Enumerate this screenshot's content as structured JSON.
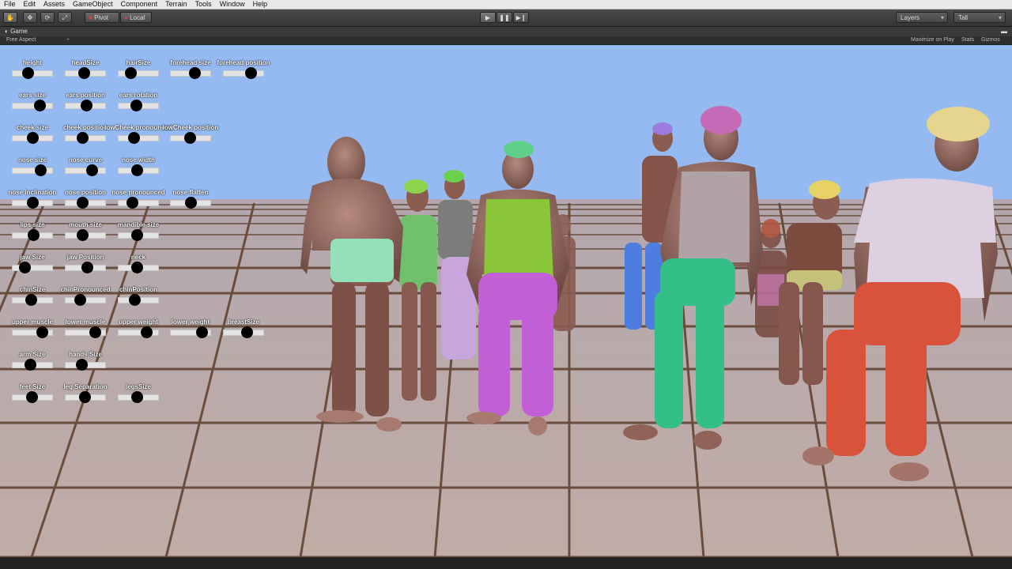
{
  "menu": [
    "File",
    "Edit",
    "Assets",
    "GameObject",
    "Component",
    "Terrain",
    "Tools",
    "Window",
    "Help"
  ],
  "toolbar": {
    "pivot": "Pivot",
    "local": "Local",
    "layers": "Layers",
    "layout": "Tall"
  },
  "tab": {
    "title": "Game"
  },
  "gamebar": {
    "aspect": "Free Aspect",
    "maximize": "Maximize on Play",
    "stats": "Stats",
    "gizmos": "Gizmos"
  },
  "sliders": [
    {
      "label": "height",
      "value": 0.35
    },
    {
      "label": "headSize",
      "value": 0.45
    },
    {
      "label": "hairSize",
      "value": 0.25
    },
    {
      "label": "forehead size",
      "value": 0.65
    },
    {
      "label": "forehead position",
      "value": 0.75
    },
    {
      "label": "ears size",
      "value": 0.75
    },
    {
      "label": "ears position",
      "value": 0.55
    },
    {
      "label": "ears rotation",
      "value": 0.42
    },
    {
      "label": "cheek size",
      "value": 0.5
    },
    {
      "label": "cheek position",
      "value": 0.4
    },
    {
      "label": "lowCheek pronounced",
      "value": 0.35
    },
    {
      "label": "lowCheek position",
      "value": 0.48
    },
    {
      "label": "nose size",
      "value": 0.78
    },
    {
      "label": "nose curve",
      "value": 0.72
    },
    {
      "label": "nose width",
      "value": 0.45
    },
    {
      "label": "nose inclination",
      "value": 0.5
    },
    {
      "label": "nose position",
      "value": 0.4
    },
    {
      "label": "nose pronounced",
      "value": 0.3
    },
    {
      "label": "nose flatten",
      "value": 0.52
    },
    {
      "label": "lips size",
      "value": 0.55
    },
    {
      "label": "mouth size",
      "value": 0.4
    },
    {
      "label": "mandible size",
      "value": 0.45
    },
    {
      "label": "jaw Size",
      "value": 0.25
    },
    {
      "label": "jaw Position",
      "value": 0.58
    },
    {
      "label": "neck",
      "value": 0.45
    },
    {
      "label": "chinSize",
      "value": 0.45
    },
    {
      "label": "chinPronounced",
      "value": 0.32
    },
    {
      "label": "chinPosition",
      "value": 0.38
    },
    {
      "label": "upper muscle",
      "value": 0.85
    },
    {
      "label": "lower muscle",
      "value": 0.85
    },
    {
      "label": "upper weight",
      "value": 0.78
    },
    {
      "label": "lower weight",
      "value": 0.88
    },
    {
      "label": "breastSize",
      "value": 0.62
    },
    {
      "label": "arm Size",
      "value": 0.42
    },
    {
      "label": "hands Size",
      "value": 0.38
    },
    {
      "label": "feet Size",
      "value": 0.48
    },
    {
      "label": "leg Separation",
      "value": 0.48
    },
    {
      "label": "legsSize",
      "value": 0.45
    }
  ],
  "colors": {
    "sky": "#95baf2",
    "floor": "#bca8a3",
    "grid": "#6a4c3d",
    "thumb": "#000000"
  }
}
